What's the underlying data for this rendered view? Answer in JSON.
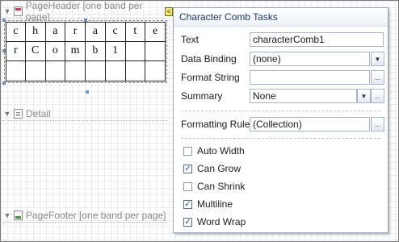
{
  "bands": {
    "page_header": "PageHeader [one band per page]",
    "detail": "Detail",
    "page_footer": "PageFooter [one band per page]"
  },
  "smart_tag": {
    "glyph": "<"
  },
  "comb": {
    "rows": [
      [
        "c",
        "h",
        "a",
        "r",
        "a",
        "c",
        "t",
        "e"
      ],
      [
        "r",
        "C",
        "o",
        "m",
        "b",
        "1",
        "",
        ""
      ],
      [
        "",
        "",
        "",
        "",
        "",
        "",
        "",
        ""
      ]
    ]
  },
  "panel": {
    "title": "Character Comb Tasks",
    "text_label": "Text",
    "text_value": "characterComb1",
    "data_binding_label": "Data Binding",
    "data_binding_value": "(none)",
    "format_string_label": "Format String",
    "format_string_value": "",
    "summary_label": "Summary",
    "summary_value": "None",
    "formatting_rules_label": "Formatting Rules",
    "formatting_rules_value": "(Collection)",
    "ellipsis": "...",
    "dropdown_glyph": "▼",
    "check_glyph": "✓",
    "options": [
      {
        "label": "Auto Width",
        "checked": false
      },
      {
        "label": "Can Grow",
        "checked": true
      },
      {
        "label": "Can Shrink",
        "checked": false
      },
      {
        "label": "Multiline",
        "checked": true
      },
      {
        "label": "Word Wrap",
        "checked": true
      }
    ]
  },
  "icons": {
    "collapse": "collapse-arrow-icon",
    "page_header_band": "page-header-band-icon",
    "detail_band": "detail-band-icon",
    "page_footer_band": "page-footer-band-icon"
  },
  "colors": {
    "panel_title_text": "#1e3a66",
    "smart_tag_bg": "#f6e66a",
    "grid_line": "#e8ecf2",
    "input_border": "#a7b5c8"
  }
}
